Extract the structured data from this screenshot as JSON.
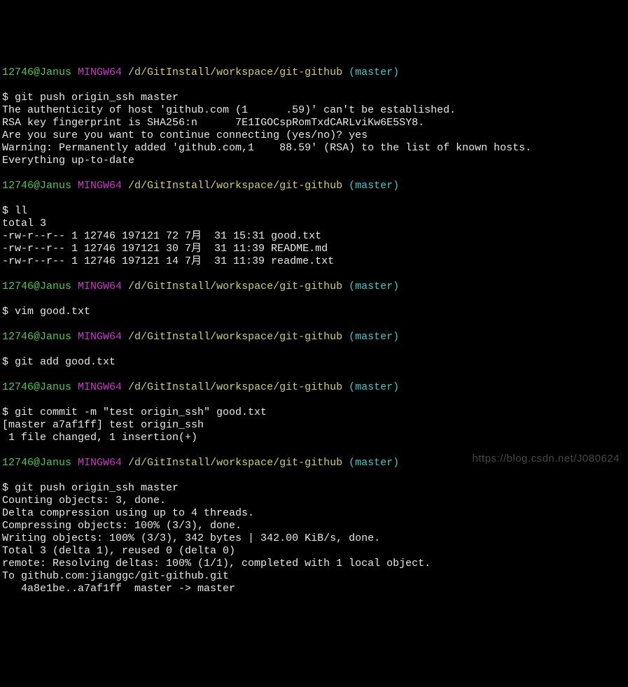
{
  "prompt": {
    "user_host": "12746@Janus ",
    "mingw": "MINGW64 ",
    "path": "/d/GitInstall/workspace/git-github ",
    "branch": "(master)"
  },
  "block1": {
    "cmd": "$ git push origin_ssh master",
    "line1a": "The authenticity of host 'github.com (1",
    "line1b_hidden": "██████",
    "line1c": ".59)' can't be established.",
    "line2a": "RSA key fingerprint is SHA256:n",
    "line2b_hidden": "██████",
    "line2c": "7E1IGOCspRomTxdCARLviKw6E5SY8.",
    "line3": "Are you sure you want to continue connecting (yes/no)? yes",
    "line4a": "Warning: Permanently added 'github.com,1",
    "line4b_hidden": "████",
    "line4c": "88.59' (RSA) to the list of known hosts.",
    "line5": "Everything up-to-date"
  },
  "block2": {
    "cmd": "$ ll",
    "line1": "total 3",
    "line2": "-rw-r--r-- 1 12746 197121 72 7月  31 15:31 good.txt",
    "line3": "-rw-r--r-- 1 12746 197121 30 7月  31 11:39 README.md",
    "line4": "-rw-r--r-- 1 12746 197121 14 7月  31 11:39 readme.txt"
  },
  "block3": {
    "cmd": "$ vim good.txt"
  },
  "block4": {
    "cmd": "$ git add good.txt"
  },
  "block5": {
    "cmd": "$ git commit -m \"test origin_ssh\" good.txt",
    "line1": "[master a7af1ff] test origin_ssh",
    "line2": " 1 file changed, 1 insertion(+)"
  },
  "block6": {
    "cmd": "$ git push origin_ssh master",
    "line1": "Counting objects: 3, done.",
    "line2": "Delta compression using up to 4 threads.",
    "line3": "Compressing objects: 100% (3/3), done.",
    "line4": "Writing objects: 100% (3/3), 342 bytes | 342.00 KiB/s, done.",
    "line5": "Total 3 (delta 1), reused 0 (delta 0)",
    "line6": "remote: Resolving deltas: 100% (1/1), completed with 1 local object.",
    "line7": "To github.com:jianggc/git-github.git",
    "line8": "   4a8e1be..a7af1ff  master -> master"
  },
  "watermark": "https://blog.csdn.net/J080624"
}
